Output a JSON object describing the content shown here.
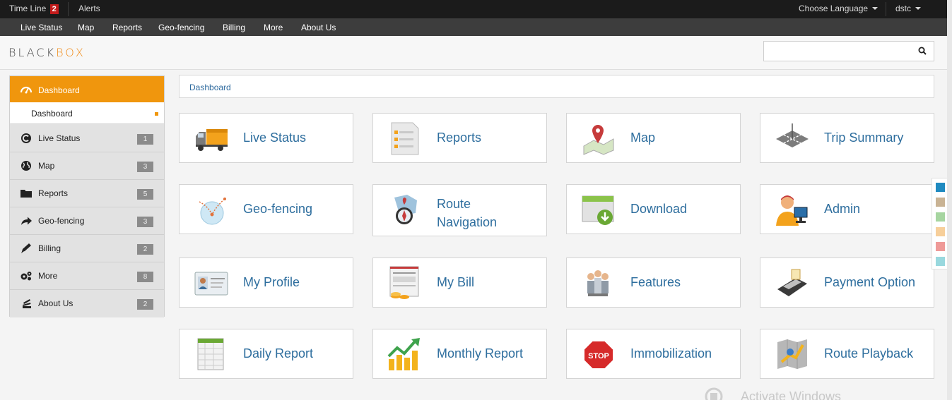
{
  "topbar": {
    "timeline_label": "Time Line",
    "timeline_count": "2",
    "alerts_label": "Alerts",
    "language_label": "Choose Language",
    "user_label": "dstc"
  },
  "navbar": {
    "items": [
      "Live Status",
      "Map",
      "Reports",
      "Geo-fencing",
      "Billing",
      "More",
      "About Us"
    ]
  },
  "header": {
    "logo_part1": "BLACK",
    "logo_part2": "BOX",
    "search_placeholder": "",
    "search_icon": "search-icon"
  },
  "sidebar": {
    "active": {
      "label": "Dashboard",
      "icon": "dashboard-gauge-icon"
    },
    "sub": {
      "label": "Dashboard"
    },
    "items": [
      {
        "label": "Live Status",
        "count": "1",
        "icon": "live-status-icon"
      },
      {
        "label": "Map",
        "count": "3",
        "icon": "globe-icon"
      },
      {
        "label": "Reports",
        "count": "5",
        "icon": "folder-icon"
      },
      {
        "label": "Geo-fencing",
        "count": "3",
        "icon": "share-arrow-icon"
      },
      {
        "label": "Billing",
        "count": "2",
        "icon": "pencil-icon"
      },
      {
        "label": "More",
        "count": "8",
        "icon": "gears-icon"
      },
      {
        "label": "About Us",
        "count": "2",
        "icon": "stack-icon"
      }
    ]
  },
  "breadcrumb": {
    "label": "Dashboard"
  },
  "tiles": [
    {
      "label": "Live Status",
      "icon": "truck-icon"
    },
    {
      "label": "Reports",
      "icon": "report-document-icon"
    },
    {
      "label": "Map",
      "icon": "map-pin-icon"
    },
    {
      "label": "Trip Summary",
      "icon": "crossroads-icon"
    },
    {
      "label": "Geo-fencing",
      "icon": "geofence-globe-icon"
    },
    {
      "label": "Route Navigation",
      "icon": "compass-map-icon"
    },
    {
      "label": "Download",
      "icon": "download-window-icon"
    },
    {
      "label": "Admin",
      "icon": "admin-user-icon"
    },
    {
      "label": "My Profile",
      "icon": "profile-card-icon"
    },
    {
      "label": "My Bill",
      "icon": "invoice-coins-icon"
    },
    {
      "label": "Features",
      "icon": "team-people-icon"
    },
    {
      "label": "Payment Option",
      "icon": "card-machine-icon"
    },
    {
      "label": "Daily Report",
      "icon": "spreadsheet-icon"
    },
    {
      "label": "Monthly Report",
      "icon": "growth-chart-icon"
    },
    {
      "label": "Immobilization",
      "icon": "stop-sign-icon"
    },
    {
      "label": "Route Playback",
      "icon": "route-map-icon"
    }
  ],
  "swatches": [
    "#1f8ac0",
    "#c9b394",
    "#a6d5a0",
    "#f7cf9a",
    "#ef9a98",
    "#99d8de"
  ],
  "watermark": {
    "text": "Activate Windows"
  },
  "colors": {
    "accent": "#f0960d",
    "link": "#2e6e9e",
    "topbar": "#1b1b1b",
    "navbar": "#3d3d3d"
  }
}
